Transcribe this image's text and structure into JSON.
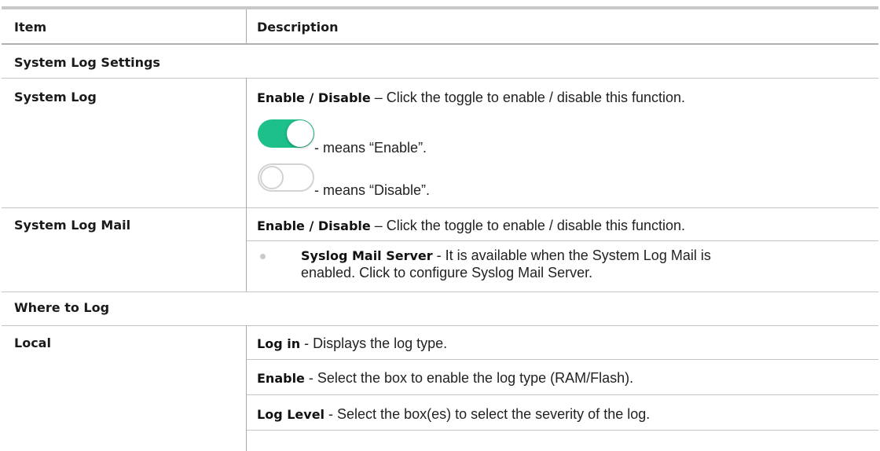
{
  "header": {
    "item": "Item",
    "description": "Description"
  },
  "sections": {
    "system_log_settings": "System Log Settings",
    "where_to_log": "Where to Log"
  },
  "rows": {
    "system_log": {
      "item": "System Log",
      "line1_bold": "Enable / Disable",
      "line1_text": " – Click the toggle to enable / disable this function.",
      "enable_text": " - means “Enable”.",
      "disable_text": " - means “Disable”."
    },
    "system_log_mail": {
      "item": "System Log Mail",
      "line1_bold": "Enable / Disable",
      "line1_text": " – Click the toggle to enable / disable this function.",
      "bullet_bold": "Syslog Mail Server",
      "bullet_text1": " - It is available when the System Log Mail is",
      "bullet_text2": "enabled. Click to configure Syslog Mail Server."
    },
    "local": {
      "item": "Local",
      "line1_bold": "Log in",
      "line1_text": " - Displays the log type.",
      "line2_bold": "Enable",
      "line2_text": " - Select the box to enable the log type (RAM/Flash).",
      "line3_bold": "Log Level",
      "line3_text": " - Select the box(es) to select the severity of the log."
    }
  },
  "colors": {
    "toggle_on": "#1dbf8a",
    "toggle_off_border": "#d2d2d2",
    "rule": "#c4c4c4"
  }
}
